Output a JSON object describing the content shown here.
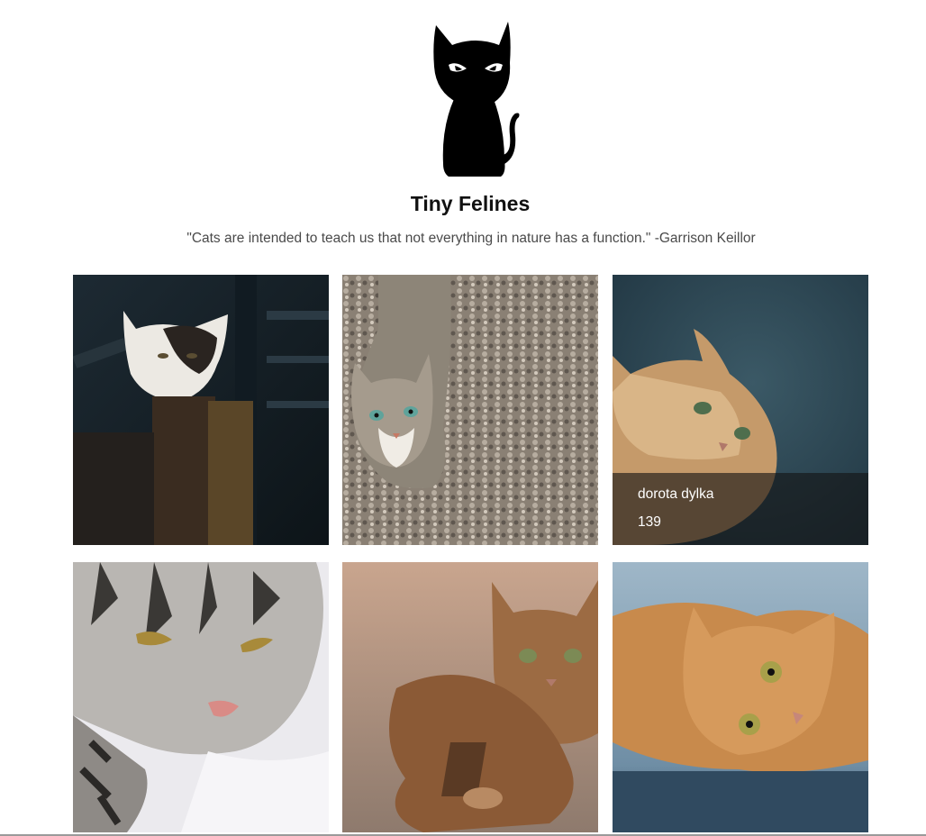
{
  "header": {
    "logo_icon": "black-cat-silhouette-icon",
    "title": "Tiny Felines",
    "quote": "\"Cats are intended to teach us that not everything in nature has a function.\" -Garrison Keillor"
  },
  "gallery": {
    "photos": [
      {
        "subject": "calico cat peeking over wooden beams",
        "author": "",
        "likes": ""
      },
      {
        "subject": "tabby cat on gravel looking up",
        "author": "",
        "likes": ""
      },
      {
        "subject": "fluffy ginger cat",
        "author": "dorota dylka",
        "likes": "139"
      },
      {
        "subject": "silver tabby cat close-up",
        "author": "",
        "likes": ""
      },
      {
        "subject": "tabby kitten lying down",
        "author": "",
        "likes": ""
      },
      {
        "subject": "orange cat lying on its side",
        "author": "",
        "likes": ""
      }
    ]
  },
  "colors": {
    "background": "#ffffff",
    "title": "#111111",
    "quote": "#4a4a4a",
    "overlay": "#141414"
  }
}
